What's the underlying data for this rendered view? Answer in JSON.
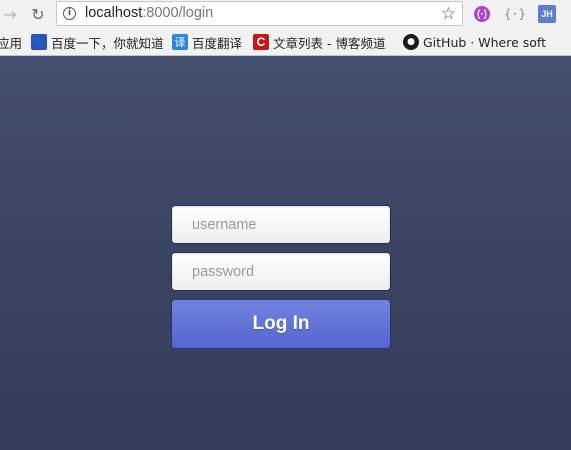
{
  "browser": {
    "url_host": "localhost",
    "url_path": ":8000/login",
    "extensions": [
      {
        "name": "ext-purple-icon",
        "label": "(·)"
      },
      {
        "name": "json-formatter-icon",
        "label": "{·}"
      },
      {
        "name": "jh-extension-icon",
        "label": "JH"
      }
    ]
  },
  "bookmarks": [
    {
      "name": "apps",
      "label": "应用",
      "icon": "apps-icon"
    },
    {
      "name": "baidu",
      "label": "百度一下，你就知道",
      "icon": "baidu-paw-icon",
      "glyph": "🐾"
    },
    {
      "name": "baidu-fanyi",
      "label": "百度翻译",
      "icon": "translate-icon",
      "glyph": "译"
    },
    {
      "name": "csdn",
      "label": "文章列表 - 博客频道",
      "icon": "csdn-icon",
      "glyph": "C"
    },
    {
      "name": "github",
      "label": "GitHub · Where soft",
      "icon": "github-icon",
      "glyph": "●"
    }
  ],
  "login": {
    "username_placeholder": "username",
    "password_placeholder": "password",
    "submit_label": "Log In"
  },
  "colors": {
    "page_background_top": "#44506f",
    "page_background_bottom": "#353d5a",
    "button_top": "#7283e0",
    "button_bottom": "#5466cf"
  }
}
